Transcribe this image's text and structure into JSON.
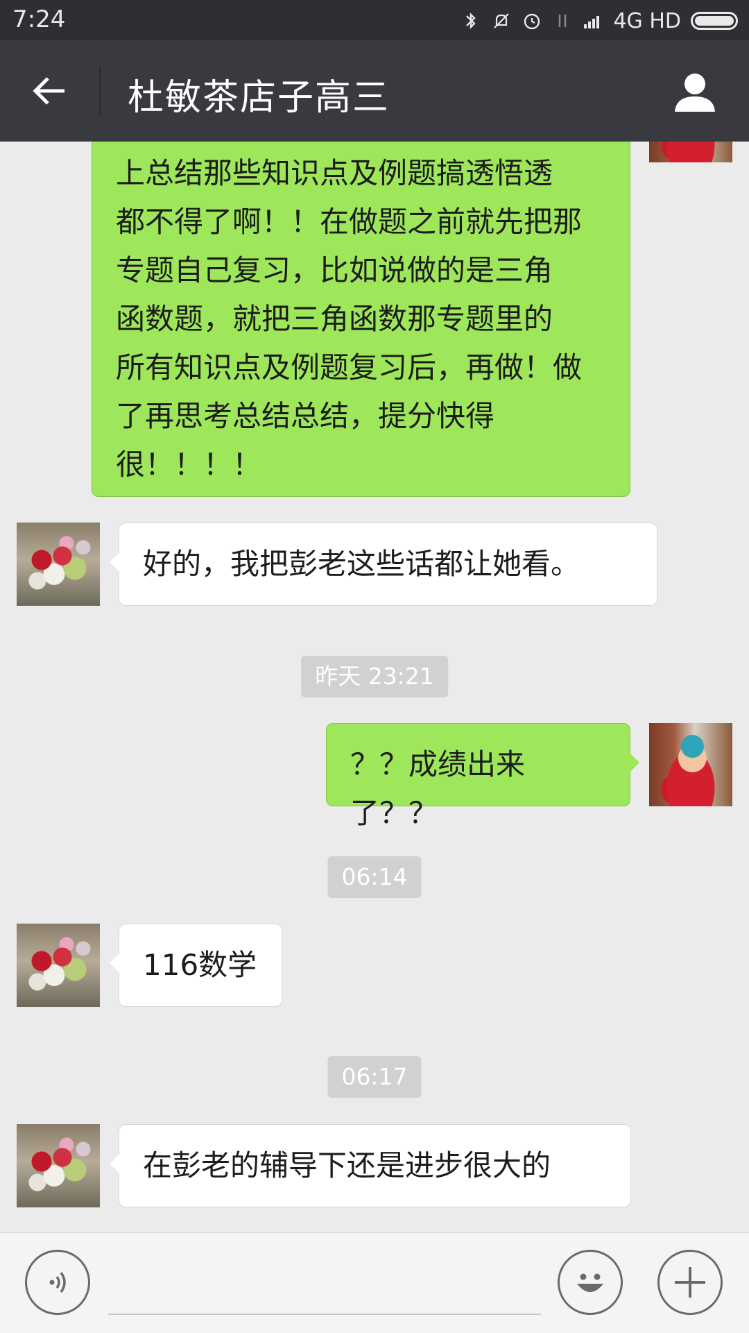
{
  "status_bar": {
    "time": "7:24",
    "network": "4G HD"
  },
  "header": {
    "title": "杜敏茶店子高三"
  },
  "messages": [
    {
      "side": "right",
      "lines": [
        "上总结那些知识点及例题搞透悟透",
        "都不得了啊！！在做题之前就先把那",
        "专题自己复习，比如说做的是三角",
        "函数题，就把三角函数那专题里的",
        "所有知识点及例题复习后，再做！做",
        "了再思考总结总结，提分快得",
        "很！！！！"
      ]
    },
    {
      "side": "left",
      "text": "好的，我把彭老这些话都让她看。"
    },
    {
      "timestamp": "昨天 23:21"
    },
    {
      "side": "right",
      "text": "？？成绩出来了？？"
    },
    {
      "timestamp": "06:14"
    },
    {
      "side": "left",
      "text": "116数学"
    },
    {
      "timestamp": "06:17"
    },
    {
      "side": "left",
      "text": "在彭老的辅导下还是进步很大的"
    }
  ],
  "colors": {
    "sent_bubble": "#9ee75a",
    "received_bubble": "#ffffff",
    "header_bg": "#383a3f",
    "chat_bg": "#ebebeb"
  },
  "icons": {
    "back": "arrow-left-icon",
    "profile": "person-icon",
    "voice": "voice-icon",
    "emoji": "smiley-icon",
    "more": "plus-icon"
  }
}
